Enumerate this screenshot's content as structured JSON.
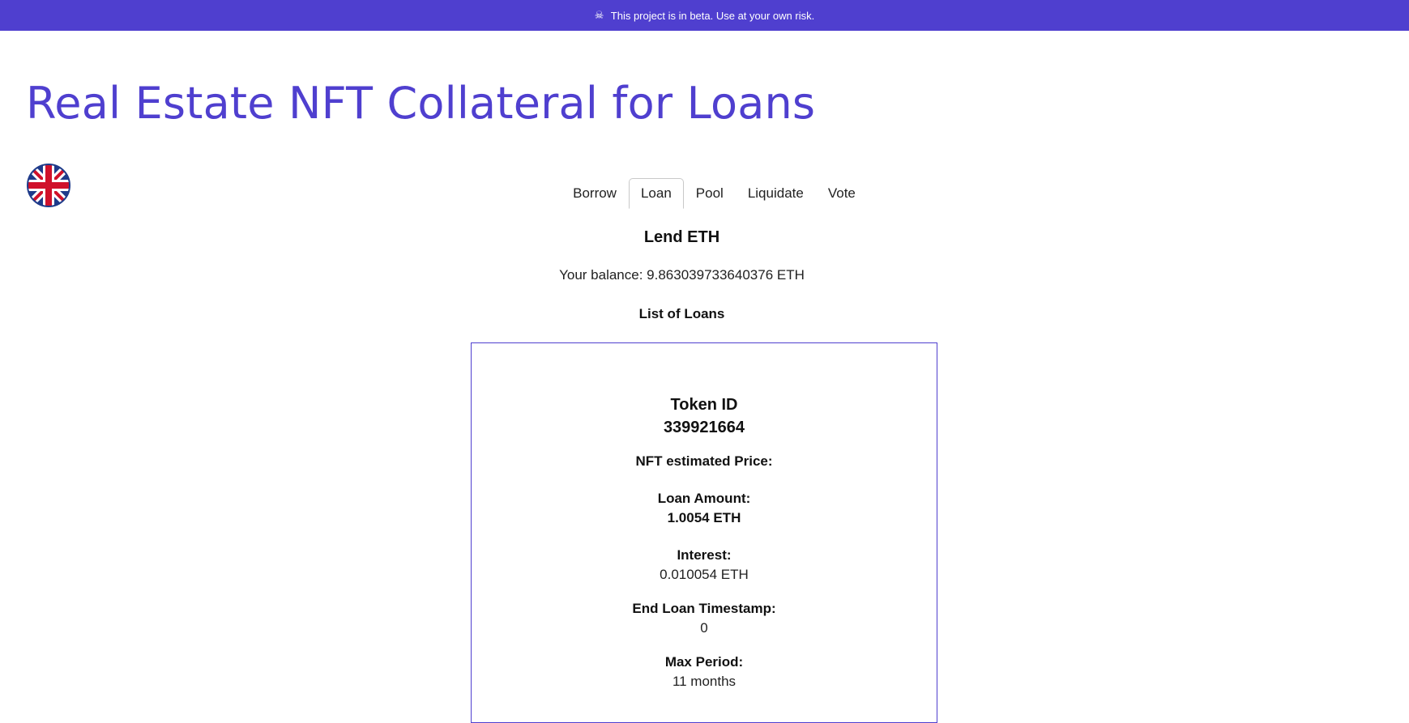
{
  "banner": {
    "icon": "skull-icon",
    "text": "This project is in beta. Use at your own risk."
  },
  "header": {
    "title": "Real Estate NFT Collateral for Loans",
    "language_icon": "uk-flag-icon"
  },
  "tabs": [
    {
      "label": "Borrow",
      "active": false
    },
    {
      "label": "Loan",
      "active": true
    },
    {
      "label": "Pool",
      "active": false
    },
    {
      "label": "Liquidate",
      "active": false
    },
    {
      "label": "Vote",
      "active": false
    }
  ],
  "main": {
    "section_title": "Lend ETH",
    "balance_text": "Your balance: 9.863039733640376 ETH",
    "list_title": "List of Loans"
  },
  "loan_card": {
    "token_label": "Token ID",
    "token_id": "339921664",
    "nft_price_label": "NFT estimated Price:",
    "loan_amount_label": "Loan Amount:",
    "loan_amount_value": "1.0054 ETH",
    "interest_label": "Interest:",
    "interest_value": "0.010054 ETH",
    "end_timestamp_label": "End Loan Timestamp:",
    "end_timestamp_value": "0",
    "max_period_label": "Max Period:",
    "max_period_value": "11 months"
  },
  "colors": {
    "brand": "#4f3fcf",
    "flag_blue": "#1f3b8a",
    "flag_red": "#d0112b"
  }
}
